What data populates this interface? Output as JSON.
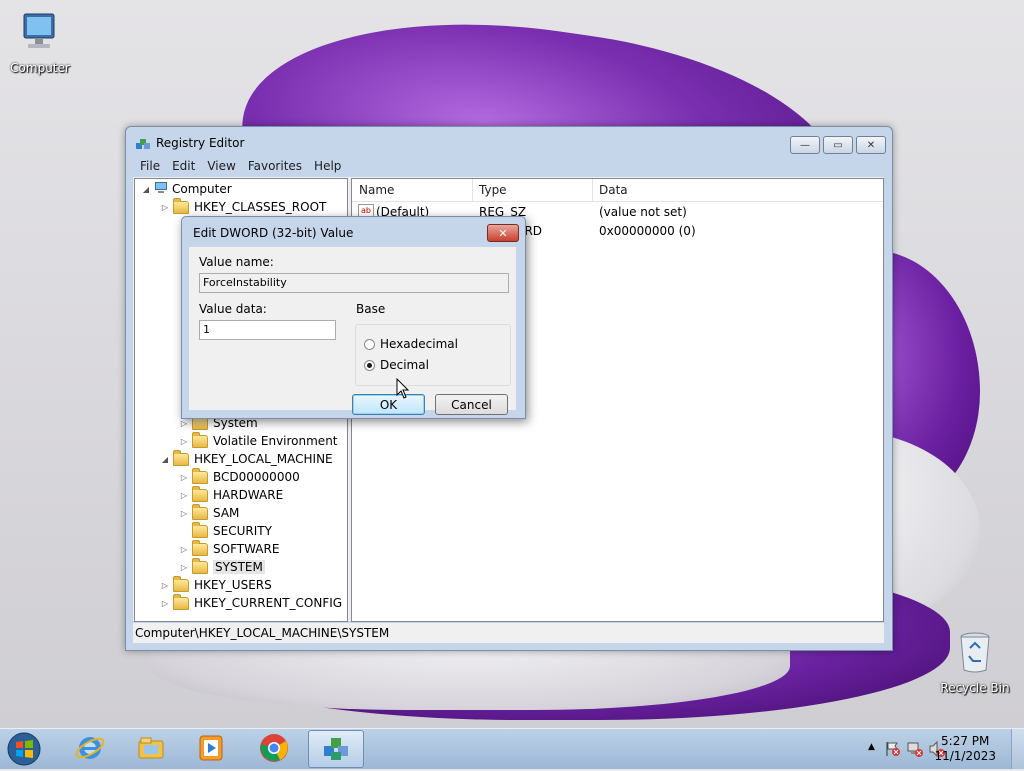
{
  "desktop": {
    "icons": [
      {
        "label": "Computer",
        "icon": "computer-icon"
      },
      {
        "label": "Recycle Bin",
        "icon": "recycle-bin-icon"
      }
    ]
  },
  "regedit": {
    "title": "Registry Editor",
    "menu": [
      "File",
      "Edit",
      "View",
      "Favorites",
      "Help"
    ],
    "tree": [
      {
        "label": "Computer",
        "level": 0,
        "expander": "expanded"
      },
      {
        "label": "HKEY_CLASSES_ROOT",
        "level": 1,
        "expander": "collapsed"
      },
      {
        "label": "System",
        "level": 2,
        "expander": "collapsed"
      },
      {
        "label": "Volatile Environment",
        "level": 2,
        "expander": "collapsed"
      },
      {
        "label": "HKEY_LOCAL_MACHINE",
        "level": 1,
        "expander": "expanded"
      },
      {
        "label": "BCD00000000",
        "level": 2,
        "expander": "collapsed"
      },
      {
        "label": "HARDWARE",
        "level": 2,
        "expander": "collapsed"
      },
      {
        "label": "SAM",
        "level": 2,
        "expander": "collapsed"
      },
      {
        "label": "SECURITY",
        "level": 2,
        "expander": "none"
      },
      {
        "label": "SOFTWARE",
        "level": 2,
        "expander": "collapsed"
      },
      {
        "label": "SYSTEM",
        "level": 2,
        "expander": "collapsed",
        "selected": true
      },
      {
        "label": "HKEY_USERS",
        "level": 1,
        "expander": "collapsed"
      },
      {
        "label": "HKEY_CURRENT_CONFIG",
        "level": 1,
        "expander": "collapsed"
      }
    ],
    "columns": [
      "Name",
      "Type",
      "Data"
    ],
    "values": [
      {
        "name": "(Default)",
        "type": "REG_SZ",
        "data": "(value not set)"
      },
      {
        "name": "",
        "type": "ORD",
        "data": "0x00000000 (0)"
      }
    ],
    "status_path": "Computer\\HKEY_LOCAL_MACHINE\\SYSTEM"
  },
  "dialog": {
    "title": "Edit DWORD (32-bit) Value",
    "value_name_label": "Value name:",
    "value_name": "ForceInstability",
    "value_data_label": "Value data:",
    "value_data": "1",
    "base_label": "Base",
    "radio_hex": "Hexadecimal",
    "radio_dec": "Decimal",
    "selected_base": "Decimal",
    "ok": "OK",
    "cancel": "Cancel"
  },
  "taskbar": {
    "apps": [
      "internet-explorer-icon",
      "file-explorer-icon",
      "media-player-icon",
      "chrome-icon",
      "registry-editor-icon"
    ],
    "active_app": "registry-editor-icon",
    "time": "5:27 PM",
    "date": "11/1/2023"
  }
}
